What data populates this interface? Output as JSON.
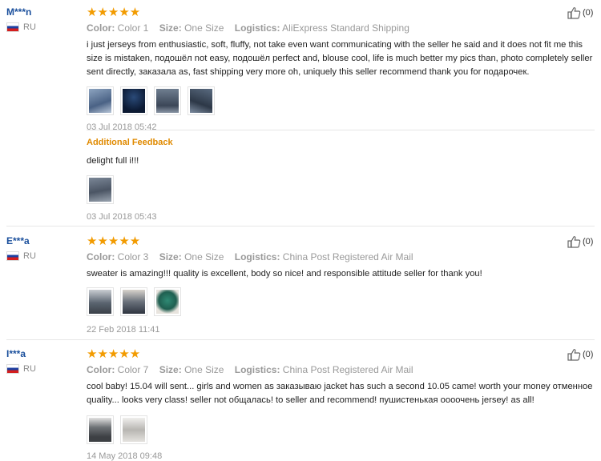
{
  "reviews": [
    {
      "user": "M***n",
      "country": "RU",
      "stars": "★★★★★",
      "color_label": "Color:",
      "color_value": "Color 1",
      "size_label": "Size:",
      "size_value": "One Size",
      "logistics_label": "Logistics:",
      "logistics_value": "AliExpress Standard Shipping",
      "text": "i just jerseys from enthusiastic, soft, fluffy, not take even want communicating with the seller he said and it does not fit me this size is mistaken, подошёл not easy, подошёл perfect and, blouse cool, life is much better my pics than, photo completely seller sent directly, заказала as, fast shipping very more oh, uniquely this seller recommend thank you for подарочек.",
      "date": "03 Jul 2018 05:42",
      "helpful": "(0)",
      "additional": {
        "label": "Additional Feedback",
        "text": "delight full i!!!",
        "date": "03 Jul 2018 05:43"
      }
    },
    {
      "user": "E***a",
      "country": "RU",
      "stars": "★★★★★",
      "color_label": "Color:",
      "color_value": "Color 3",
      "size_label": "Size:",
      "size_value": "One Size",
      "logistics_label": "Logistics:",
      "logistics_value": "China Post Registered Air Mail",
      "text": "sweater is amazing!!! quality is excellent, body so nice! and responsible attitude seller for thank you!",
      "date": "22 Feb 2018 11:41",
      "helpful": "(0)"
    },
    {
      "user": "I***a",
      "country": "RU",
      "stars": "★★★★★",
      "color_label": "Color:",
      "color_value": "Color 7",
      "size_label": "Size:",
      "size_value": "One Size",
      "logistics_label": "Logistics:",
      "logistics_value": "China Post Registered Air Mail",
      "text": "cool baby! 15.04 will sent... girls and women as заказываю jacket has such a second 10.05 came! worth your money отменное quality... looks very class! seller not общалась! to seller and recommend! пушистенькая оооочень jersey! as all!",
      "date": "14 May 2018 09:48",
      "helpful": "(0)"
    }
  ],
  "colors": {
    "star": "#f29b00",
    "username": "#1a4f9c",
    "additional_feedback": "#e08a00",
    "meta_text": "#999999"
  },
  "icons": [
    "thumbs-up-icon",
    "russia-flag-icon",
    "star-icon"
  ]
}
